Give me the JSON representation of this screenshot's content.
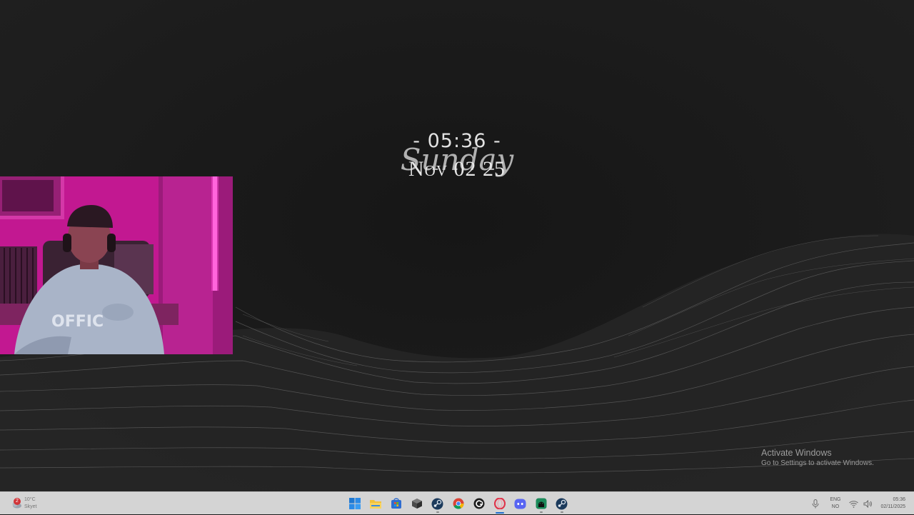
{
  "clock_widget": {
    "time": "- 05:36 -",
    "day": "Sunday",
    "date": "Nov 02 25"
  },
  "watermark": {
    "title": "Activate Windows",
    "subtitle": "Go to Settings to activate Windows."
  },
  "taskbar": {
    "weather": {
      "badge": "2",
      "temp": "10°C",
      "condition": "Skyet"
    },
    "apps": [
      {
        "name": "start-icon"
      },
      {
        "name": "file-explorer-icon"
      },
      {
        "name": "microsoft-store-icon"
      },
      {
        "name": "cube-app-icon"
      },
      {
        "name": "steam-icon"
      },
      {
        "name": "chrome-icon"
      },
      {
        "name": "circular-arrow-app-icon"
      },
      {
        "name": "opera-icon"
      },
      {
        "name": "discord-icon"
      },
      {
        "name": "android-app-icon"
      },
      {
        "name": "steam-icon-2"
      }
    ],
    "language": {
      "line1": "ENG",
      "line2": "NO"
    },
    "clock": {
      "time": "05:36",
      "date": "02/11/2025"
    }
  },
  "colors": {
    "taskbar": "#d4d4d4",
    "desktop": "#1b1b1b",
    "webcam_light": "#d21ea2"
  }
}
